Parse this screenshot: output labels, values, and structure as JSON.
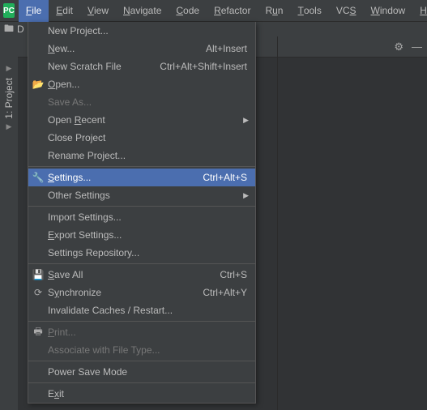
{
  "app_icon": "PC",
  "menubar": [
    "File",
    "Edit",
    "View",
    "Navigate",
    "Code",
    "Refactor",
    "Run",
    "Tools",
    "VCS",
    "Window",
    "Help"
  ],
  "menubar_mn": [
    "F",
    "E",
    "V",
    "N",
    "C",
    "R",
    "u",
    "T",
    "S",
    "W",
    "H"
  ],
  "menubar_open_index": 0,
  "breadcrumb_text": "D",
  "side_tool": {
    "label": "1: Project"
  },
  "editor_top_icons": {
    "gear": "⚙",
    "minimize": "—"
  },
  "dropdown": [
    {
      "type": "item",
      "label": "New Project..."
    },
    {
      "type": "item",
      "label": "New...",
      "mn": "N",
      "shortcut": "Alt+Insert"
    },
    {
      "type": "item",
      "label": "New Scratch File",
      "shortcut": "Ctrl+Alt+Shift+Insert"
    },
    {
      "type": "item",
      "label": "Open...",
      "mn": "O",
      "icon": "open"
    },
    {
      "type": "item",
      "label": "Save As...",
      "disabled": true
    },
    {
      "type": "item",
      "label": "Open Recent",
      "mn": "R",
      "submenu": true
    },
    {
      "type": "item",
      "label": "Close Project"
    },
    {
      "type": "item",
      "label": "Rename Project..."
    },
    {
      "type": "sep"
    },
    {
      "type": "item",
      "label": "Settings...",
      "mn": "S",
      "shortcut": "Ctrl+Alt+S",
      "icon": "settings",
      "selected": true
    },
    {
      "type": "item",
      "label": "Other Settings",
      "submenu": true
    },
    {
      "type": "sep"
    },
    {
      "type": "item",
      "label": "Import Settings..."
    },
    {
      "type": "item",
      "label": "Export Settings...",
      "mn": "E"
    },
    {
      "type": "item",
      "label": "Settings Repository..."
    },
    {
      "type": "sep"
    },
    {
      "type": "item",
      "label": "Save All",
      "mn": "S",
      "shortcut": "Ctrl+S",
      "icon": "save"
    },
    {
      "type": "item",
      "label": "Synchronize",
      "mn": "y",
      "shortcut": "Ctrl+Alt+Y",
      "icon": "sync"
    },
    {
      "type": "item",
      "label": "Invalidate Caches / Restart..."
    },
    {
      "type": "sep"
    },
    {
      "type": "item",
      "label": "Print...",
      "mn": "P",
      "icon": "print",
      "disabled": true
    },
    {
      "type": "item",
      "label": "Associate with File Type...",
      "disabled": true
    },
    {
      "type": "sep"
    },
    {
      "type": "item",
      "label": "Power Save Mode"
    },
    {
      "type": "sep"
    },
    {
      "type": "item",
      "label": "Exit",
      "mn": "x"
    }
  ],
  "icons": {
    "open": "📂",
    "settings": "🔧",
    "save": "💾",
    "sync": "⟳",
    "print": "🖶"
  }
}
